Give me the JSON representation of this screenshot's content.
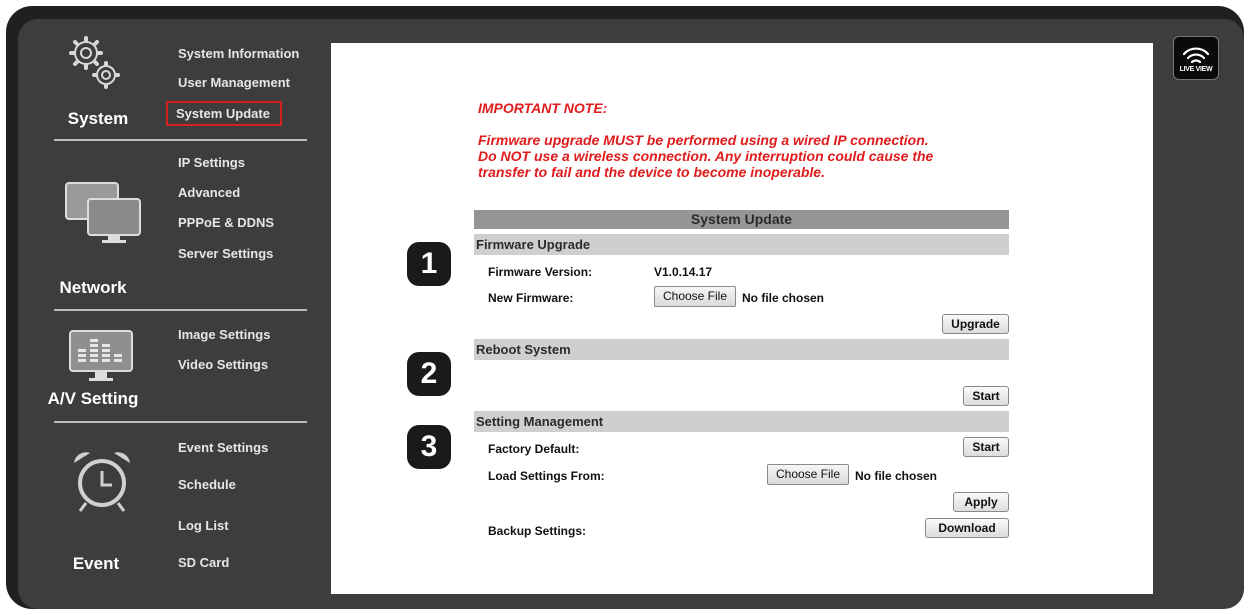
{
  "sidebar": {
    "categories": [
      {
        "label": "System",
        "icon": "gears-icon",
        "items": [
          "System Information",
          "User Management",
          "System Update"
        ]
      },
      {
        "label": "Network",
        "icon": "monitors-icon",
        "items": [
          "IP Settings",
          "Advanced",
          "PPPoE & DDNS",
          "Server Settings"
        ]
      },
      {
        "label": "A/V Setting",
        "icon": "equalizer-monitor-icon",
        "items": [
          "Image Settings",
          "Video Settings"
        ]
      },
      {
        "label": "Event",
        "icon": "alarm-clock-icon",
        "items": [
          "Event Settings",
          "Schedule",
          "Log List",
          "SD Card"
        ]
      }
    ],
    "selected": "System Update"
  },
  "live_view": {
    "label": "LIVE VIEW",
    "icon": "wifi-signal-icon"
  },
  "note": {
    "title": "IMPORTANT NOTE:",
    "lines": [
      "Firmware upgrade MUST be performed using a wired IP connection.",
      "Do NOT use a wireless connection. Any interruption could cause the",
      "transfer to fail and the device to become inoperable."
    ]
  },
  "update": {
    "title": "System Update",
    "firmware": {
      "step": "1",
      "heading": "Firmware Upgrade",
      "version_label": "Firmware Version:",
      "version_value": "V1.0.14.17",
      "new_label": "New Firmware:",
      "choose_label": "Choose File",
      "file_status": "No file chosen",
      "upgrade_label": "Upgrade"
    },
    "reboot": {
      "step": "2",
      "heading": "Reboot System",
      "start_label": "Start"
    },
    "settings": {
      "step": "3",
      "heading": "Setting Management",
      "factory_label": "Factory Default:",
      "factory_button": "Start",
      "load_label": "Load Settings From:",
      "choose_label": "Choose File",
      "file_status": "No file chosen",
      "apply_label": "Apply",
      "backup_label": "Backup Settings:",
      "download_label": "Download"
    }
  },
  "colors": {
    "accent_red": "#e01b1b",
    "selection_border": "#d42020",
    "panel_bg": "#3d3d3d"
  }
}
